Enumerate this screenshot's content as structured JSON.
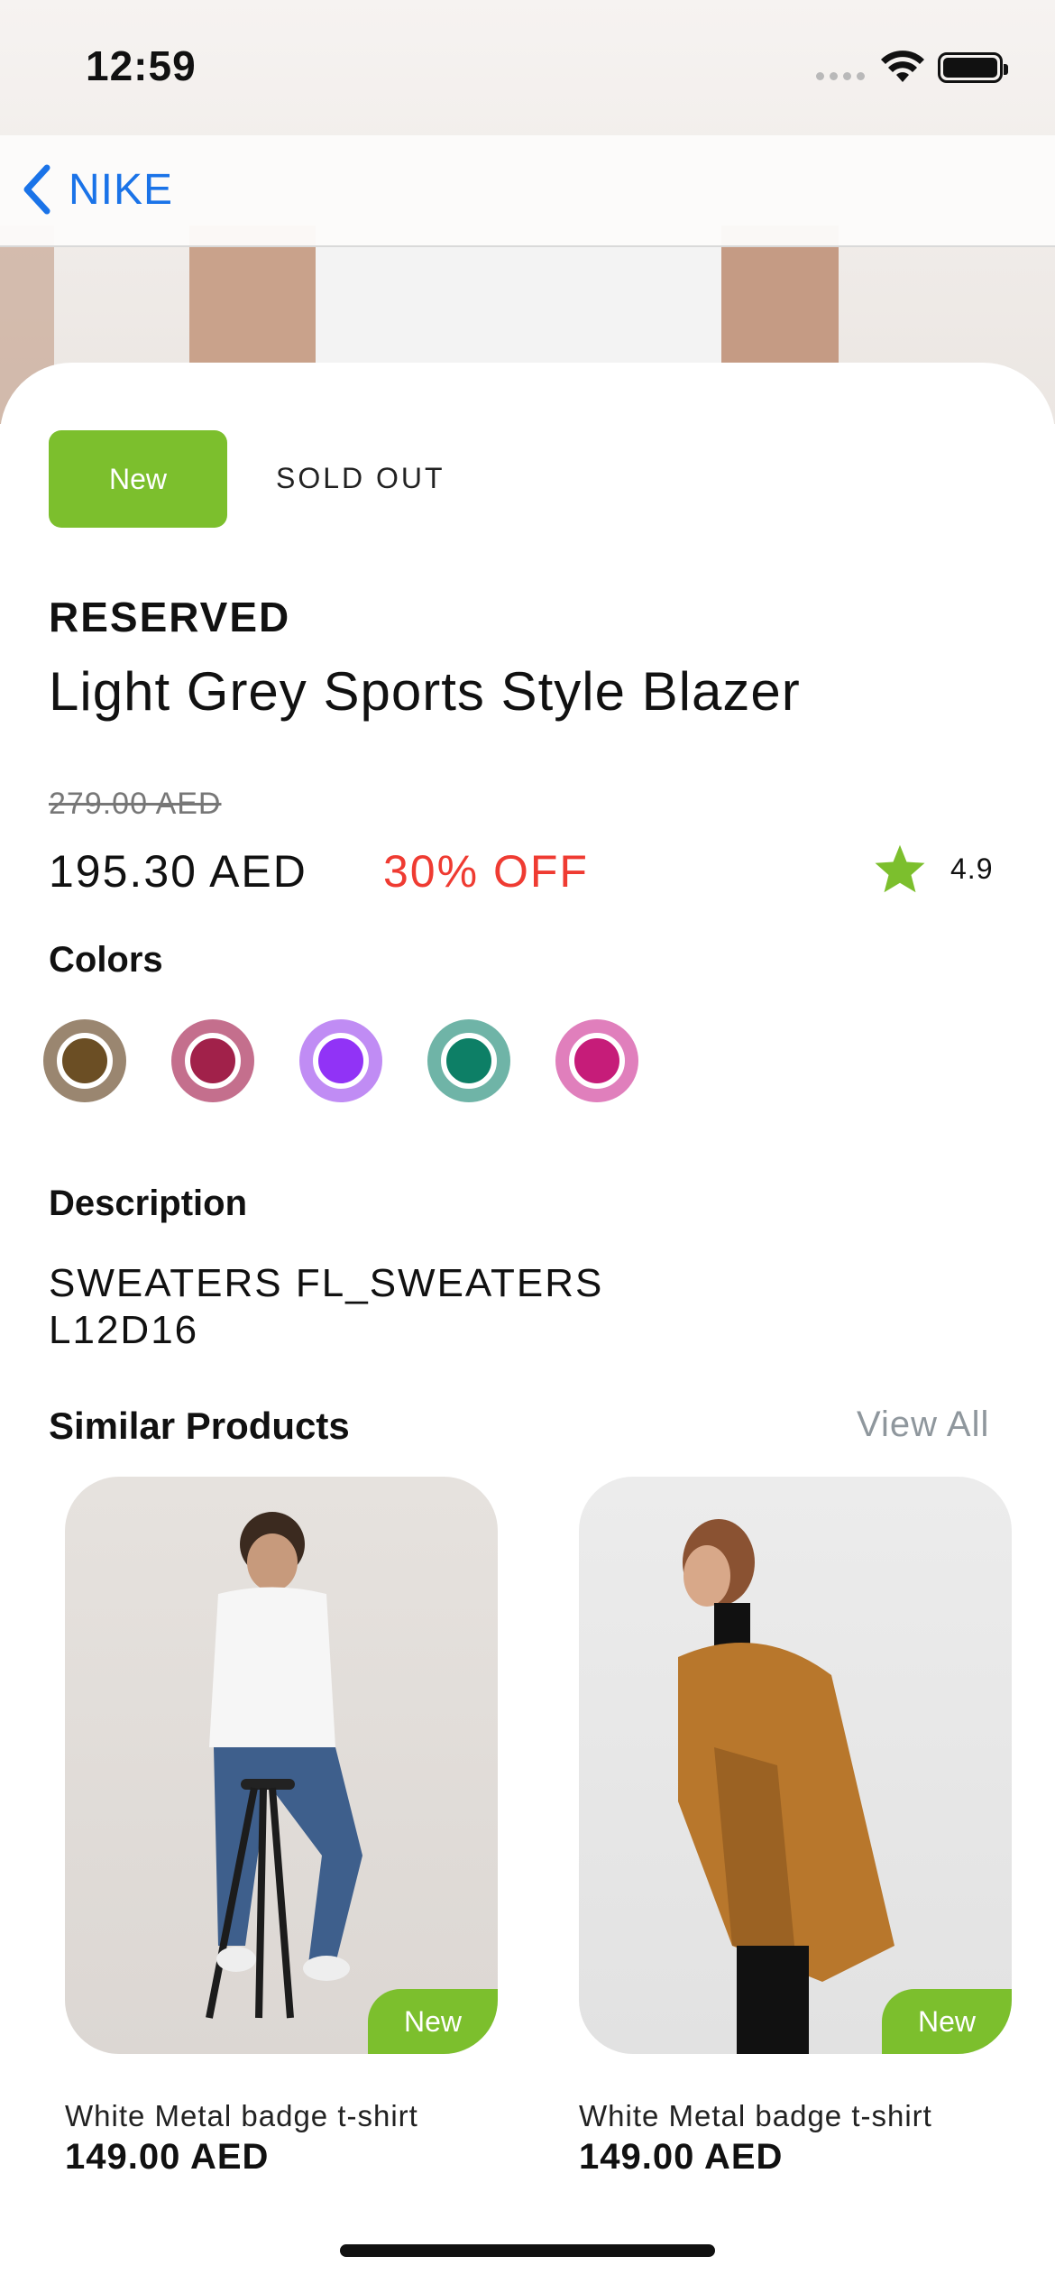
{
  "status_bar": {
    "time": "12:59"
  },
  "nav": {
    "back_label": "NIKE"
  },
  "product": {
    "badge": "New",
    "availability": "SOLD OUT",
    "brand": "RESERVED",
    "title": "Light Grey Sports Style Blazer",
    "old_price": "279.00 AED",
    "price": "195.30 AED",
    "discount": "30% OFF",
    "rating": "4.9",
    "colors_title": "Colors",
    "colors": [
      {
        "ring": "#9a8670",
        "fill": "#6b4e24"
      },
      {
        "ring": "#c46f8d",
        "fill": "#a1214a"
      },
      {
        "ring": "#c08cf4",
        "fill": "#9133f6"
      },
      {
        "ring": "#6fb4a7",
        "fill": "#0d7f66"
      },
      {
        "ring": "#e07fbc",
        "fill": "#c61c79"
      }
    ],
    "description_title": "Description",
    "description": "SWEATERS FL_SWEATERS L12D16"
  },
  "similar": {
    "title": "Similar Products",
    "view_all": "View All",
    "items": [
      {
        "tag": "New",
        "name": "White Metal badge t-shirt",
        "price": "149.00 AED"
      },
      {
        "tag": "New",
        "name": "White Metal badge t-shirt",
        "price": "149.00 AED"
      }
    ]
  },
  "colors": {
    "accent_green": "#7cbf2d",
    "discount_red": "#ef3b32",
    "link_blue": "#1a73e8"
  }
}
